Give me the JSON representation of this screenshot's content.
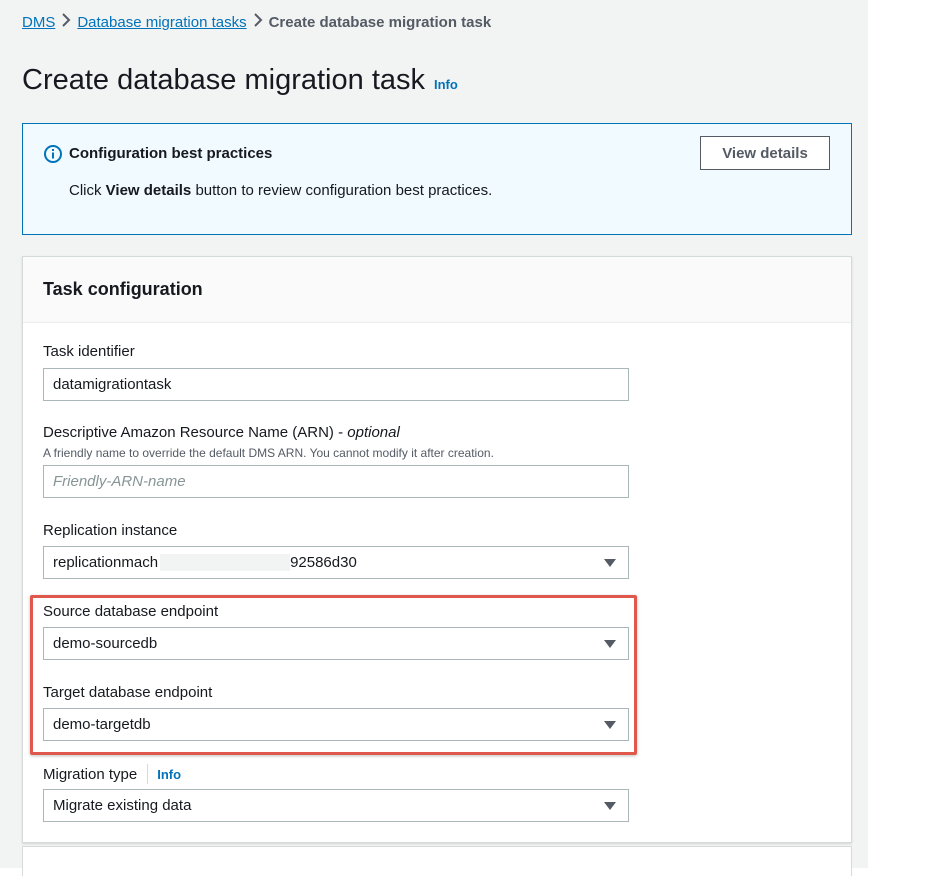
{
  "breadcrumb": {
    "root": "DMS",
    "parent": "Database migration tasks",
    "current": "Create database migration task",
    "separator_icon": "chevron-right-icon"
  },
  "page": {
    "title": "Create database migration task",
    "info_link": "Info"
  },
  "flash": {
    "icon": "info-circle-icon",
    "title": "Configuration best practices",
    "text_prefix": "Click ",
    "text_bold": "View details",
    "text_suffix": " button to review configuration best practices.",
    "button_label": "View details"
  },
  "task_configuration": {
    "title": "Task configuration",
    "task_identifier": {
      "label": "Task identifier",
      "value": "datamigrationtask"
    },
    "arn": {
      "label": "Descriptive Amazon Resource Name (ARN) - ",
      "label_optional": "optional",
      "description": "A friendly name to override the default DMS ARN. You cannot modify it after creation.",
      "placeholder": "Friendly-ARN-name",
      "value": ""
    },
    "replication_instance": {
      "label": "Replication instance",
      "value_prefix": "replicationmach",
      "value_suffix": "92586d30"
    },
    "source_endpoint": {
      "label": "Source database endpoint",
      "value": "demo-sourcedb"
    },
    "target_endpoint": {
      "label": "Target database endpoint",
      "value": "demo-targetdb"
    },
    "migration_type": {
      "label": "Migration type",
      "info_link": "Info",
      "value": "Migrate existing data"
    }
  },
  "colors": {
    "link": "#0073bb",
    "highlight_border": "#e0574b",
    "flash_background": "#f1faff"
  }
}
